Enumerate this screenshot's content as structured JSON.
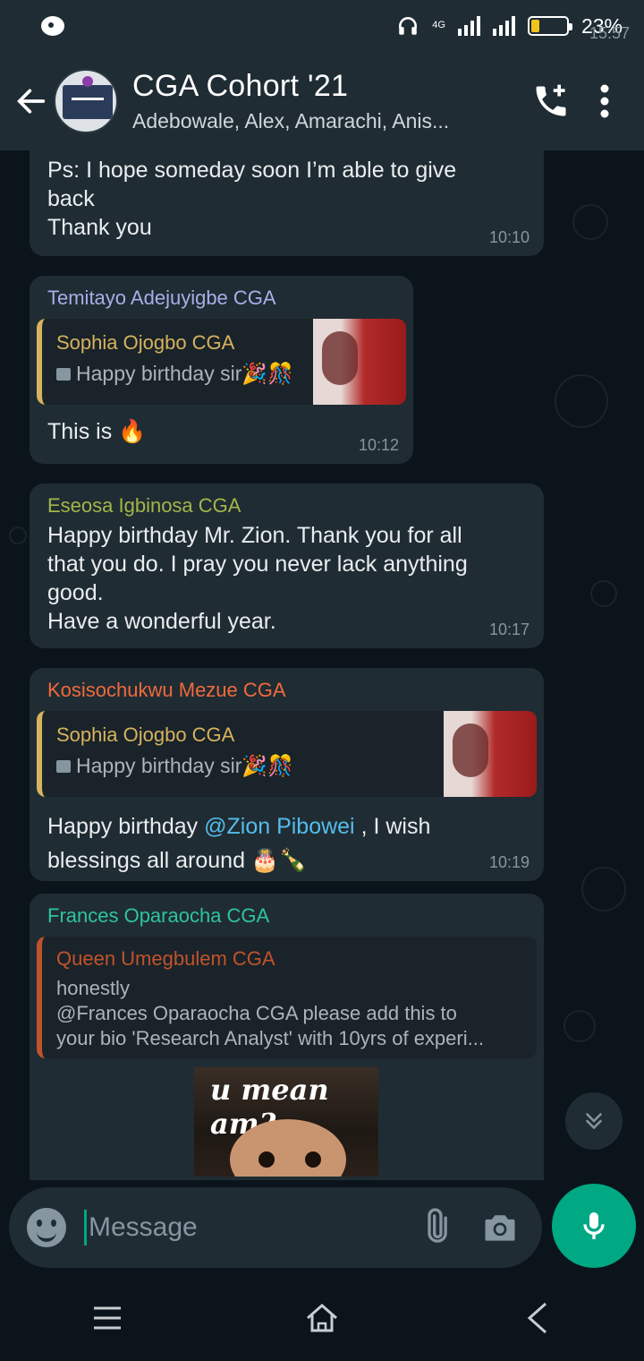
{
  "status_bar": {
    "time": "15:57",
    "network": "4G",
    "battery": "23%"
  },
  "header": {
    "title": "CGA Cohort '21",
    "members": "Adebowale, Alex, Amarachi, Anis..."
  },
  "messages": [
    {
      "text_lines": [
        "Ps: I hope someday soon I’m able to give",
        "back",
        "Thank you"
      ],
      "time": "10:10"
    },
    {
      "sender": "Temitayo Adejuyigbe CGA",
      "sender_color": "#a5b0e8",
      "quote": {
        "name": "Sophia Ojogbo CGA",
        "text": "Happy birthday sir🎉🎊"
      },
      "text": "This is 🔥",
      "time": "10:12"
    },
    {
      "sender": "Eseosa Igbinosa CGA",
      "sender_color": "#a4b648",
      "text_lines": [
        "Happy birthday Mr. Zion. Thank you for all",
        "that you do. I pray you never lack anything",
        "good.",
        "Have a wonderful year."
      ],
      "time": "10:17"
    },
    {
      "sender": "Kosisochukwu Mezue CGA",
      "sender_color": "#f06a3b",
      "quote": {
        "name": "Sophia Ojogbo CGA",
        "text": "Happy birthday sir🎉🎊"
      },
      "text_pre": "Happy birthday ",
      "mention": "@Zion Pibowei",
      "text_post": " , I wish",
      "text_line2": "blessings all around 🎂🍾",
      "time": "10:19"
    },
    {
      "sender": "Frances Oparaocha CGA",
      "sender_color": "#2dc4a0",
      "quote": {
        "name": "Queen Umegbulem CGA",
        "line1": "honestly",
        "line2": "@Frances Oparaocha CGA please add this to",
        "line3": "your bio 'Research Analyst' with 10yrs of experi..."
      },
      "sticker_caption": "u mean am?"
    }
  ],
  "input": {
    "placeholder": "Message"
  }
}
